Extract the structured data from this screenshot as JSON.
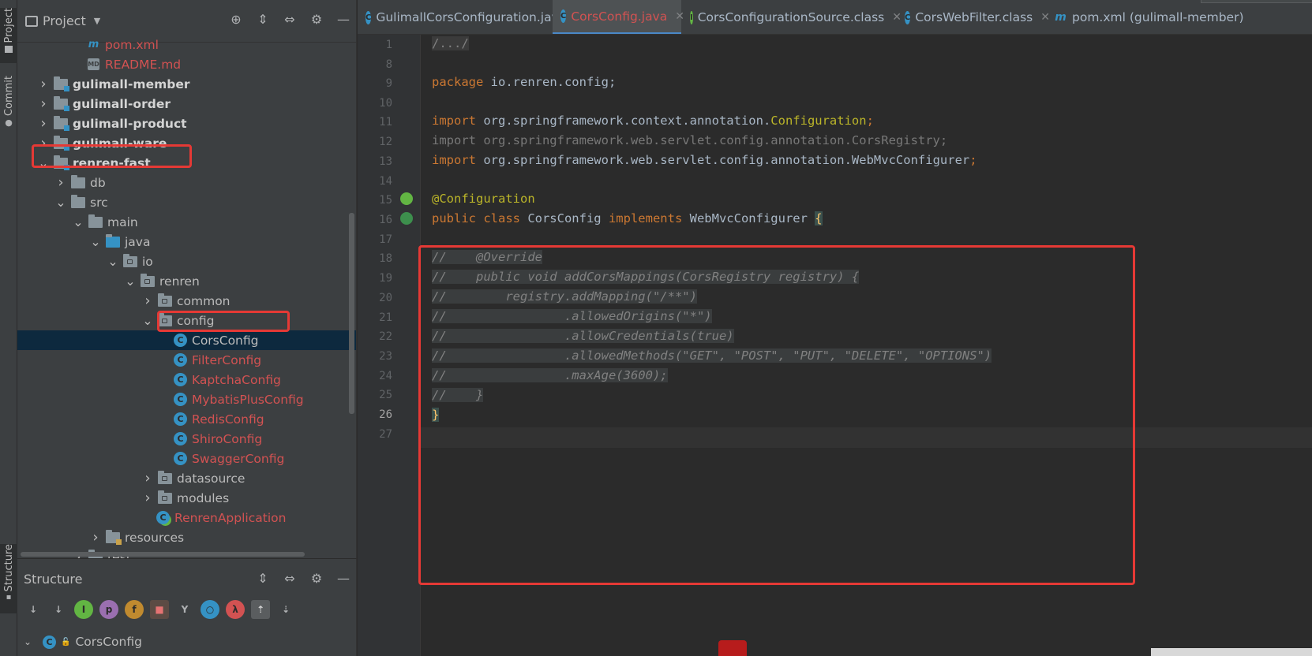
{
  "left_strip": {
    "project_label": "Project",
    "commit_label": "Commit",
    "structure_label": "Structure"
  },
  "project_panel": {
    "title": "Project",
    "tree": [
      {
        "label": "pom.xml",
        "icon": "maven-file-icon",
        "style": "red",
        "depth": 3,
        "expand": ""
      },
      {
        "label": "README.md",
        "icon": "markdown-file-icon",
        "style": "red",
        "depth": 3,
        "expand": ""
      },
      {
        "label": "gulimall-member",
        "icon": "module-folder-icon",
        "style": "bold",
        "depth": 1,
        "expand": "collapsed"
      },
      {
        "label": "gulimall-order",
        "icon": "module-folder-icon",
        "style": "bold",
        "depth": 1,
        "expand": "collapsed"
      },
      {
        "label": "gulimall-product",
        "icon": "module-folder-icon",
        "style": "bold",
        "depth": 1,
        "expand": "collapsed"
      },
      {
        "label": "gulimall-ware",
        "icon": "module-folder-icon",
        "style": "bold",
        "depth": 1,
        "expand": "collapsed"
      },
      {
        "label": "renren-fast",
        "icon": "module-folder-icon",
        "style": "bold",
        "depth": 1,
        "expand": "expanded"
      },
      {
        "label": "db",
        "icon": "folder-icon",
        "style": "norm",
        "depth": 2,
        "expand": "collapsed"
      },
      {
        "label": "src",
        "icon": "folder-icon",
        "style": "norm",
        "depth": 2,
        "expand": "expanded"
      },
      {
        "label": "main",
        "icon": "folder-icon",
        "style": "norm",
        "depth": 3,
        "expand": "expanded"
      },
      {
        "label": "java",
        "icon": "source-folder-icon",
        "style": "norm",
        "depth": 4,
        "expand": "expanded"
      },
      {
        "label": "io",
        "icon": "package-icon",
        "style": "norm",
        "depth": 5,
        "expand": "expanded"
      },
      {
        "label": "renren",
        "icon": "package-icon",
        "style": "norm",
        "depth": 6,
        "expand": "expanded"
      },
      {
        "label": "common",
        "icon": "package-icon",
        "style": "norm",
        "depth": 7,
        "expand": "collapsed"
      },
      {
        "label": "config",
        "icon": "package-icon",
        "style": "norm",
        "depth": 7,
        "expand": "expanded"
      },
      {
        "label": "CorsConfig",
        "icon": "class-icon",
        "style": "selected",
        "depth": 8,
        "expand": ""
      },
      {
        "label": "FilterConfig",
        "icon": "class-icon",
        "style": "red",
        "depth": 8,
        "expand": ""
      },
      {
        "label": "KaptchaConfig",
        "icon": "class-icon",
        "style": "red",
        "depth": 8,
        "expand": ""
      },
      {
        "label": "MybatisPlusConfig",
        "icon": "class-icon",
        "style": "red",
        "depth": 8,
        "expand": ""
      },
      {
        "label": "RedisConfig",
        "icon": "class-icon",
        "style": "red",
        "depth": 8,
        "expand": ""
      },
      {
        "label": "ShiroConfig",
        "icon": "class-icon",
        "style": "red",
        "depth": 8,
        "expand": ""
      },
      {
        "label": "SwaggerConfig",
        "icon": "class-icon",
        "style": "red",
        "depth": 8,
        "expand": ""
      },
      {
        "label": "datasource",
        "icon": "package-icon",
        "style": "norm",
        "depth": 7,
        "expand": "collapsed"
      },
      {
        "label": "modules",
        "icon": "package-icon",
        "style": "norm",
        "depth": 7,
        "expand": "collapsed"
      },
      {
        "label": "RenrenApplication",
        "icon": "spring-boot-class-icon",
        "style": "red",
        "depth": 7,
        "expand": ""
      },
      {
        "label": "resources",
        "icon": "resources-folder-icon",
        "style": "norm",
        "depth": 4,
        "expand": "collapsed"
      },
      {
        "label": "test",
        "icon": "folder-icon",
        "style": "norm",
        "depth": 3,
        "expand": "collapsed"
      }
    ]
  },
  "structure_panel": {
    "title": "Structure",
    "root_label": "CorsConfig"
  },
  "tabs": [
    {
      "label": "GulimallCorsConfiguration.java",
      "icon": "class-icon",
      "active": false,
      "closable": false
    },
    {
      "label": "CorsConfig.java",
      "icon": "class-icon",
      "active": true,
      "closable": true
    },
    {
      "label": "CorsConfigurationSource.class",
      "icon": "interface-icon",
      "active": false,
      "closable": true
    },
    {
      "label": "CorsWebFilter.class",
      "icon": "class-icon",
      "active": false,
      "closable": true
    },
    {
      "label": "pom.xml (gulimall-member)",
      "icon": "maven-file-icon",
      "active": false,
      "closable": false
    }
  ],
  "editor": {
    "line_numbers": [
      "1",
      "8",
      "9",
      "10",
      "11",
      "12",
      "13",
      "14",
      "15",
      "16",
      "17",
      "18",
      "19",
      "20",
      "21",
      "22",
      "23",
      "24",
      "25",
      "26",
      "27"
    ],
    "current_line": "26",
    "code": {
      "l1": "/.../",
      "l9_kw": "package",
      "l9_rest": " io.renren.config;",
      "l11_kw": "import",
      "l11_pkg": " org.springframework.context.annotation.",
      "l11_cls": "Configuration",
      "l11_end": ";",
      "l12": "import org.springframework.web.servlet.config.annotation.CorsRegistry;",
      "l13_kw": "import",
      "l13_pkg": " org.springframework.web.servlet.config.annotation.WebMvcConfigurer",
      "l13_end": ";",
      "l15": "@Configuration",
      "l16_kw1": "public class",
      "l16_name": " CorsConfig ",
      "l16_kw2": "implements",
      "l16_iface": " WebMvcConfigurer ",
      "l16_brace": "{",
      "l18": "//    @Override",
      "l19": "//    public void addCorsMappings(CorsRegistry registry) {",
      "l20": "//        registry.addMapping(\"/**\")",
      "l21": "//                .allowedOrigins(\"*\")",
      "l22": "//                .allowCredentials(true)",
      "l23": "//                .allowedMethods(\"GET\", \"POST\", \"PUT\", \"DELETE\", \"OPTIONS\")",
      "l24": "//                .maxAge(3600);",
      "l25": "//    }",
      "l26": "}"
    }
  },
  "colors": {
    "accent_blue": "#4a88c7",
    "highlight_red": "#e53935",
    "keyword": "#cc7832",
    "annotation": "#bbb529",
    "comment": "#808080"
  }
}
